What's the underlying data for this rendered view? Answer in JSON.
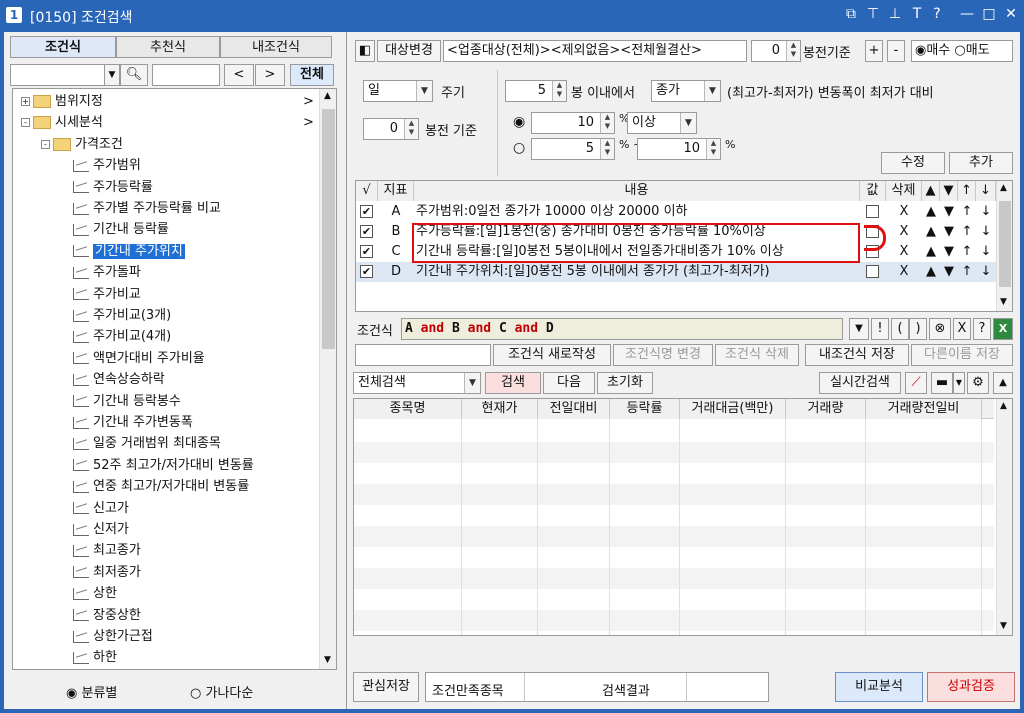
{
  "window": {
    "number": "1",
    "title": "[0150] 조건검색",
    "title_icons": [
      "window-icon",
      "pin-icon",
      "pin2-icon",
      "font-icon",
      "help-icon",
      "minimize-icon",
      "maximize-icon",
      "close-icon"
    ]
  },
  "left": {
    "tabs": [
      "조건식",
      "추천식",
      "내조건식"
    ],
    "search": {
      "value": "",
      "placeholder": "",
      "nav_prev": "<",
      "nav_next": ">",
      "all_button": "전체"
    },
    "tree": [
      {
        "label": "범위지정",
        "level": 0,
        "type": "folder",
        "expander": "+",
        "arrow": ">"
      },
      {
        "label": "시세분석",
        "level": 0,
        "type": "folder",
        "expander": "-",
        "arrow": ">"
      },
      {
        "label": "가격조건",
        "level": 1,
        "type": "folder",
        "expander": "-"
      },
      {
        "label": "주가범위",
        "level": 2,
        "type": "item"
      },
      {
        "label": "주가등락률",
        "level": 2,
        "type": "item"
      },
      {
        "label": "주가별 주가등락률 비교",
        "level": 2,
        "type": "item"
      },
      {
        "label": "기간내 등락률",
        "level": 2,
        "type": "item"
      },
      {
        "label": "기간내 주가위치",
        "level": 2,
        "type": "item",
        "selected": true
      },
      {
        "label": "주가돌파",
        "level": 2,
        "type": "item"
      },
      {
        "label": "주가비교",
        "level": 2,
        "type": "item"
      },
      {
        "label": "주가비교(3개)",
        "level": 2,
        "type": "item"
      },
      {
        "label": "주가비교(4개)",
        "level": 2,
        "type": "item"
      },
      {
        "label": "액면가대비 주가비율",
        "level": 2,
        "type": "item"
      },
      {
        "label": "연속상승하락",
        "level": 2,
        "type": "item"
      },
      {
        "label": "기간내 등락봉수",
        "level": 2,
        "type": "item"
      },
      {
        "label": "기간내 주가변동폭",
        "level": 2,
        "type": "item"
      },
      {
        "label": "일중 거래범위 최대종목",
        "level": 2,
        "type": "item"
      },
      {
        "label": "52주 최고가/저가대비 변동률",
        "level": 2,
        "type": "item"
      },
      {
        "label": "연중 최고가/저가대비 변동률",
        "level": 2,
        "type": "item"
      },
      {
        "label": "신고가",
        "level": 2,
        "type": "item"
      },
      {
        "label": "신저가",
        "level": 2,
        "type": "item"
      },
      {
        "label": "최고종가",
        "level": 2,
        "type": "item"
      },
      {
        "label": "최저종가",
        "level": 2,
        "type": "item"
      },
      {
        "label": "상한",
        "level": 2,
        "type": "item"
      },
      {
        "label": "장중상한",
        "level": 2,
        "type": "item"
      },
      {
        "label": "상한가근접",
        "level": 2,
        "type": "item"
      },
      {
        "label": "하한",
        "level": 2,
        "type": "item"
      }
    ],
    "sort_options": [
      {
        "label": "분류별",
        "checked": true
      },
      {
        "label": "가나다순",
        "checked": false
      }
    ]
  },
  "right": {
    "target_button": "대상변경",
    "target_text": "<업종대상(전체)><제외없음><전체월결산>",
    "bong_value": "0",
    "bong_label": "봉전기준",
    "plus": "+",
    "minus": "-",
    "buy_sell": [
      {
        "label": "매수",
        "checked": true
      },
      {
        "label": "매도",
        "checked": false
      }
    ],
    "period": {
      "value": "일",
      "label": "주기"
    },
    "bong_before": {
      "value": "0",
      "label": "봉전 기준"
    },
    "within": {
      "value": "5",
      "label": "봉 이내에서",
      "price_type": "종가",
      "suffix": "(최고가-최저가) 변동폭이 최저가 대비"
    },
    "range1": {
      "value": "10",
      "unit": "%",
      "op": "이상",
      "checked": true
    },
    "range2": {
      "from": "5",
      "from_unit": "% ~",
      "to": "10",
      "to_unit": "%",
      "checked": false
    },
    "edit_button": "수정",
    "add_button": "추가",
    "grid": {
      "headers": [
        "√",
        "지표",
        "내용",
        "값",
        "삭제",
        "▲",
        "▼",
        "↑",
        "↓"
      ],
      "rows": [
        {
          "checked": true,
          "id": "A",
          "content": "주가범위:0일전 종가가 10000 이상 20000 이하",
          "del": "X",
          "highlight": false
        },
        {
          "checked": true,
          "id": "B",
          "content": "주가등락률:[일]1봉전(중) 종가대비 0봉전 종가등락률 10%이상",
          "del": "X",
          "highlight": false
        },
        {
          "checked": true,
          "id": "C",
          "content": "기간내 등락률:[일]0봉전 5봉이내에서 전일종가대비종가 10% 이상",
          "del": "X",
          "highlight": false
        },
        {
          "checked": true,
          "id": "D",
          "content": "기간내 주가위치:[일]0봉전 5봉 이내에서 종가가 (최고가-최저가)",
          "del": "X",
          "highlight": true
        }
      ]
    },
    "condition": {
      "label": "조건식",
      "tokens": [
        "A",
        "and",
        "B",
        "and",
        "C",
        "and",
        "D"
      ],
      "buttons": [
        "▼",
        "!",
        "(",
        ")",
        "⊗",
        "X",
        "?",
        "excel"
      ]
    },
    "actions": {
      "name_value": "",
      "new": "조건식 새로작성",
      "rename": "조건식명 변경",
      "delete": "조건식 삭제",
      "save": "내조건식 저장",
      "save_as": "다른이름 저장"
    },
    "search_bar": {
      "scope": "전체검색",
      "search": "검색",
      "next": "다음",
      "reset": "초기화",
      "realtime": "실시간검색"
    },
    "results": {
      "headers": [
        "종목명",
        "현재가",
        "전일대비",
        "등락률",
        "거래대금(백만)",
        "거래량",
        "거래량전일비"
      ],
      "rows": []
    },
    "footer": {
      "interest_save": "관심저장",
      "satisfy_label": "조건만족종목",
      "satisfy_value": "",
      "result_label": "검색결과",
      "result_value": "",
      "compare": "비교분석",
      "verify": "성과검증"
    }
  },
  "colors": {
    "titlebar": "#2a66b8",
    "selection": "#1e6fd6",
    "highlight_box": "#e01010",
    "condition_op": "#c00000",
    "compare_btn": "#dbe9fb",
    "verify_btn": "#fbdede",
    "search_btn": "#fbdede"
  }
}
